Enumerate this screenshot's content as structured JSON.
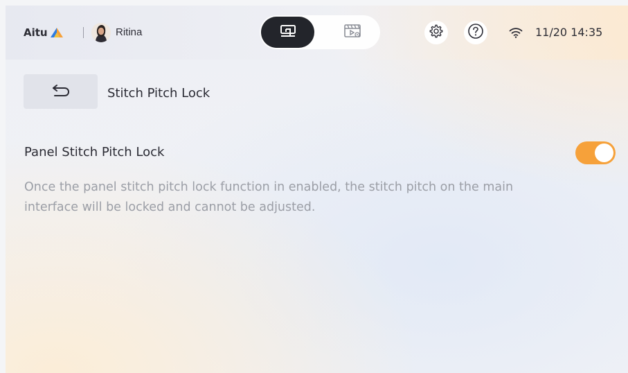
{
  "header": {
    "brand": "Aitu",
    "user_name": "Ritina",
    "datetime": "11/20 14:35",
    "icons": {
      "sewing_mode": "sewing-machine-icon",
      "preview_mode": "video-preview-icon",
      "settings": "gear-icon",
      "help": "help-icon",
      "wifi": "wifi-icon"
    }
  },
  "page": {
    "title": "Stitch Pitch Lock"
  },
  "setting": {
    "label": "Panel Stitch Pitch Lock",
    "enabled": true,
    "description": "Once the panel stitch pitch lock function in enabled, the stitch pitch on the main interface will be locked and cannot be adjusted."
  },
  "colors": {
    "accent": "#f6a13a",
    "dark": "#23252b",
    "muted_text": "#9b9ea6"
  }
}
